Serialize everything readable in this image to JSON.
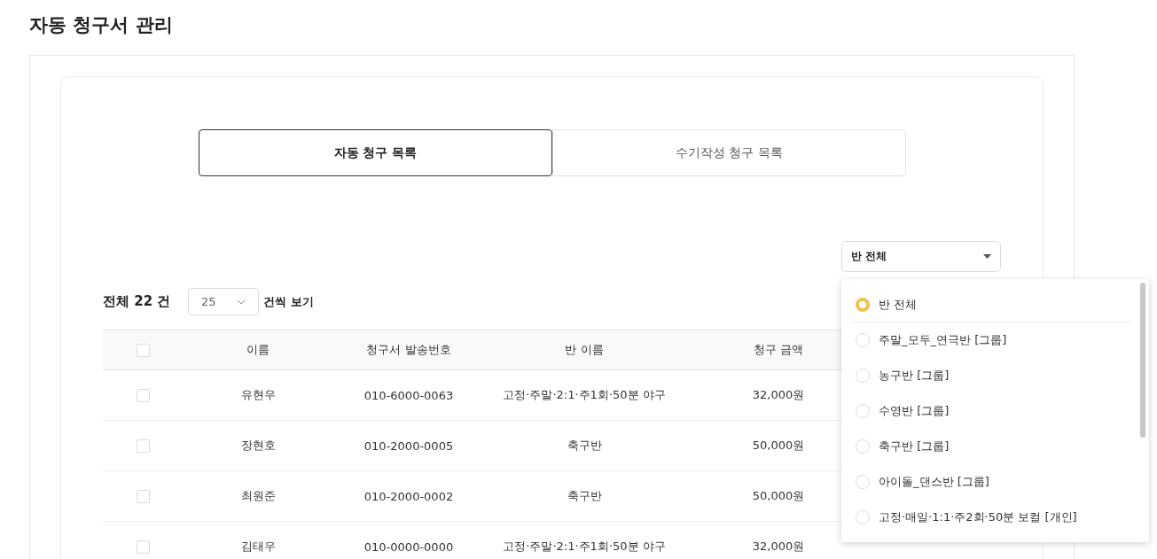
{
  "page_title": "자동 청구서 관리",
  "tabs": [
    {
      "label": "자동 청구 목록",
      "selected": true
    },
    {
      "label": "수기작성 청구 목록",
      "selected": false
    }
  ],
  "class_filter": {
    "value": "반 전체",
    "expanded": true,
    "options": [
      {
        "label": "반 전체",
        "selected": true
      },
      {
        "label": "주말_모두_연극반 [그룹]",
        "selected": false
      },
      {
        "label": "농구반 [그룹]",
        "selected": false
      },
      {
        "label": "수영반 [그룹]",
        "selected": false
      },
      {
        "label": "축구반 [그룹]",
        "selected": false
      },
      {
        "label": "아이돌_댄스반 [그룹]",
        "selected": false
      },
      {
        "label": "고정·매일·1:1·주2회·50분 보컬 [개인]",
        "selected": false
      }
    ]
  },
  "total_count": "전체 22 건",
  "page_size": {
    "value": "25"
  },
  "page_size_suffix": "건씩 보기",
  "table": {
    "all_checked": false,
    "columns": [
      "이름",
      "청구서 발송번호",
      "반 이름",
      "청구 금액"
    ],
    "rows": [
      {
        "checked": false,
        "cells": [
          "유현우",
          "010-6000-0063",
          "고정·주말·2:1·주1회·50분 야구",
          "32,000원"
        ]
      },
      {
        "checked": false,
        "cells": [
          "장현호",
          "010-2000-0005",
          "축구반",
          "50,000원"
        ]
      },
      {
        "checked": false,
        "cells": [
          "최원준",
          "010-2000-0002",
          "축구반",
          "50,000원"
        ]
      },
      {
        "checked": false,
        "cells": [
          "김태우",
          "010-0000-0000",
          "고정·주말·2:1·주1회·50분 야구",
          "32,000원"
        ]
      }
    ]
  }
}
